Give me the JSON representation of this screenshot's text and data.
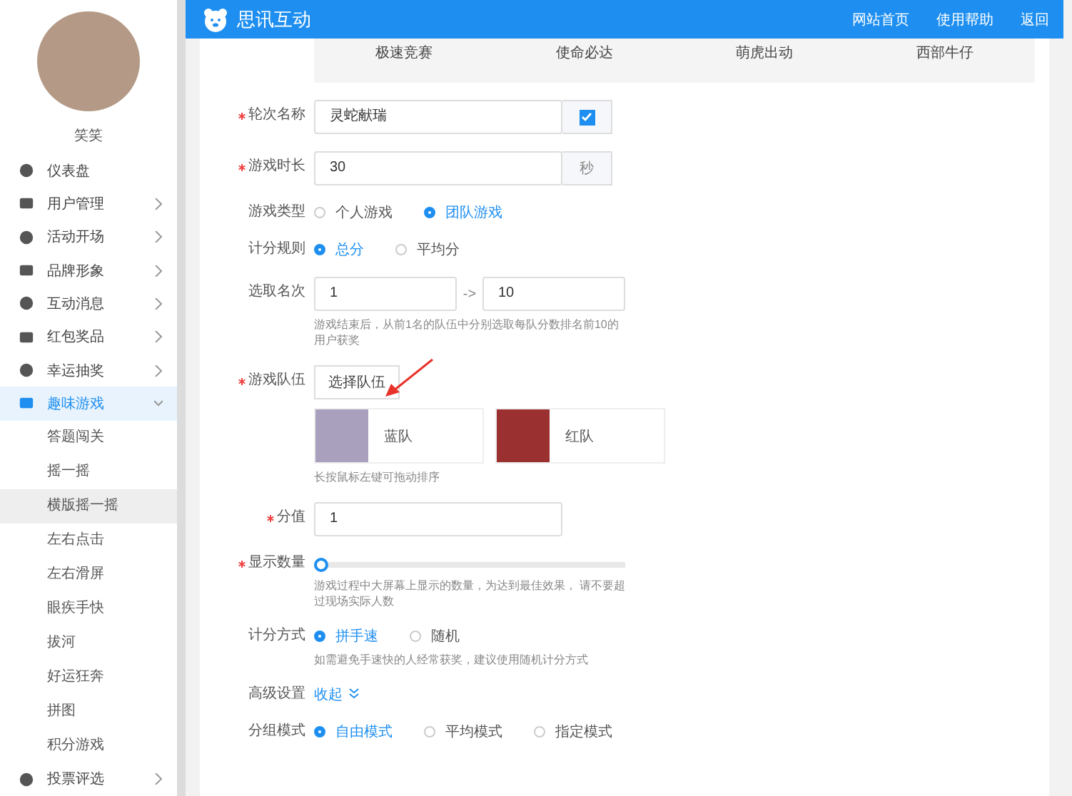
{
  "header": {
    "brand": "思讯互动",
    "nav": [
      "网站首页",
      "使用帮助",
      "返回"
    ]
  },
  "sidebar": {
    "user_name": "笑笑",
    "items": [
      {
        "label": "仪表盘",
        "selected": false,
        "expanded": false,
        "has_arrow": false
      },
      {
        "label": "用户管理",
        "selected": false,
        "expanded": false,
        "has_arrow": true
      },
      {
        "label": "活动开场",
        "selected": false,
        "expanded": false,
        "has_arrow": true
      },
      {
        "label": "品牌形象",
        "selected": false,
        "expanded": false,
        "has_arrow": true
      },
      {
        "label": "互动消息",
        "selected": false,
        "expanded": false,
        "has_arrow": true
      },
      {
        "label": "红包奖品",
        "selected": false,
        "expanded": false,
        "has_arrow": true
      },
      {
        "label": "幸运抽奖",
        "selected": false,
        "expanded": false,
        "has_arrow": true
      },
      {
        "label": "趣味游戏",
        "selected": true,
        "expanded": true,
        "has_arrow": true,
        "children": [
          {
            "label": "答题闯关",
            "selected": false
          },
          {
            "label": "摇一摇",
            "selected": false
          },
          {
            "label": "横版摇一摇",
            "selected": true
          },
          {
            "label": "左右点击",
            "selected": false
          },
          {
            "label": "左右滑屏",
            "selected": false
          },
          {
            "label": "眼疾手快",
            "selected": false
          },
          {
            "label": "拔河",
            "selected": false
          },
          {
            "label": "好运狂奔",
            "selected": false
          },
          {
            "label": "拼图",
            "selected": false
          },
          {
            "label": "积分游戏",
            "selected": false
          }
        ]
      },
      {
        "label": "投票评选",
        "selected": false,
        "expanded": false,
        "has_arrow": true
      }
    ]
  },
  "games": [
    "极速竞赛",
    "使命必达",
    "萌虎出动",
    "西部牛仔"
  ],
  "form": [
    {
      "kind": "input",
      "label": "轮次名称",
      "required": true,
      "value": "灵蛇献瑞",
      "addon": {
        "kind": "checkbox",
        "checked": true
      }
    },
    {
      "kind": "input",
      "label": "游戏时长",
      "required": true,
      "value": "30",
      "addon": {
        "kind": "text",
        "text": "秒"
      }
    },
    {
      "kind": "radio",
      "label": "游戏类型",
      "required": false,
      "options": [
        {
          "label": "个人游戏",
          "selected": false
        },
        {
          "label": "团队游戏",
          "selected": true
        }
      ]
    },
    {
      "kind": "radio",
      "label": "计分规则",
      "required": false,
      "options": [
        {
          "label": "总分",
          "selected": true
        },
        {
          "label": "平均分",
          "selected": false
        }
      ]
    },
    {
      "kind": "range",
      "label": "选取名次",
      "required": false,
      "from": "1",
      "separator": "->",
      "to": "10",
      "hint": "游戏结束后，从前1名的队伍中分别选取每队分数排名前10的用户获奖"
    },
    {
      "kind": "teams",
      "label": "游戏队伍",
      "required": true,
      "button": "选择队伍",
      "teams": [
        {
          "name": "蓝队"
        },
        {
          "name": "红队"
        }
      ],
      "hint": "长按鼠标左键可拖动排序"
    },
    {
      "kind": "input",
      "label": "分值",
      "required": true,
      "value": "1"
    },
    {
      "kind": "slider",
      "label": "显示数量",
      "required": true,
      "level": 0,
      "hint": "游戏过程中大屏幕上显示的数量，为达到最佳效果， 请不要超过现场实际人数"
    },
    {
      "kind": "radio",
      "label": "计分方式",
      "required": false,
      "options": [
        {
          "label": "拼手速",
          "selected": true
        },
        {
          "label": "随机",
          "selected": false
        }
      ],
      "hint": "如需避免手速快的人经常获奖，建议使用随机计分方式"
    },
    {
      "kind": "link",
      "label": "高级设置",
      "required": false,
      "link": "收起"
    },
    {
      "kind": "radio",
      "label": "分组模式",
      "required": false,
      "options": [
        {
          "label": "自由模式",
          "selected": true
        },
        {
          "label": "平均模式",
          "selected": false
        },
        {
          "label": "指定模式",
          "selected": false
        }
      ]
    }
  ]
}
